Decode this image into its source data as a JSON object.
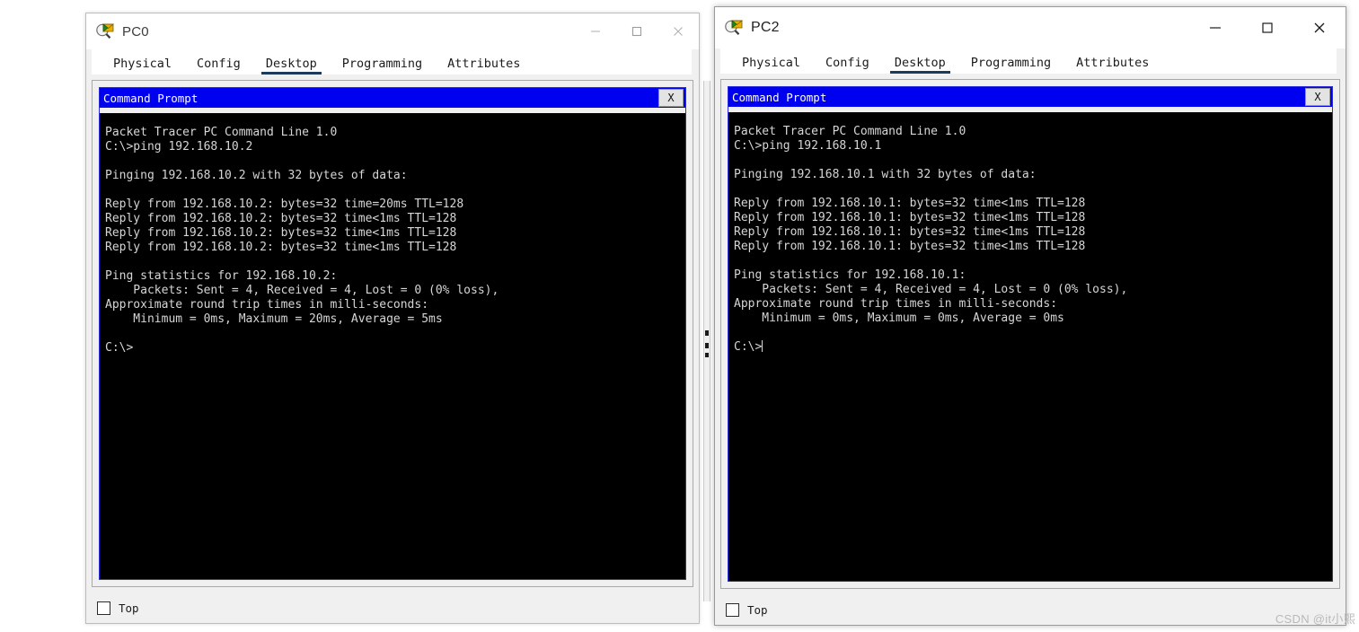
{
  "watermark": "CSDN @it小熙",
  "windows": [
    {
      "id": "pc0",
      "title": "PC0",
      "icon": "packet-tracer-device-icon",
      "controls": {
        "minimize": "–",
        "maximize": "□",
        "close": "✕"
      },
      "tabs": [
        {
          "label": "Physical",
          "selected": false
        },
        {
          "label": "Config",
          "selected": false
        },
        {
          "label": "Desktop",
          "selected": true
        },
        {
          "label": "Programming",
          "selected": false
        },
        {
          "label": "Attributes",
          "selected": false
        }
      ],
      "command_prompt": {
        "title": "Command Prompt",
        "close_label": "X",
        "show_cursor": false,
        "lines": [
          "Packet Tracer PC Command Line 1.0",
          "C:\\>ping 192.168.10.2",
          "",
          "Pinging 192.168.10.2 with 32 bytes of data:",
          "",
          "Reply from 192.168.10.2: bytes=32 time=20ms TTL=128",
          "Reply from 192.168.10.2: bytes=32 time<1ms TTL=128",
          "Reply from 192.168.10.2: bytes=32 time<1ms TTL=128",
          "Reply from 192.168.10.2: bytes=32 time<1ms TTL=128",
          "",
          "Ping statistics for 192.168.10.2:",
          "    Packets: Sent = 4, Received = 4, Lost = 0 (0% loss),",
          "Approximate round trip times in milli-seconds:",
          "    Minimum = 0ms, Maximum = 20ms, Average = 5ms",
          "",
          "C:\\>"
        ]
      },
      "footer": {
        "checkbox_label": "Top",
        "checked": false
      }
    },
    {
      "id": "pc2",
      "title": "PC2",
      "icon": "packet-tracer-device-icon",
      "controls": {
        "minimize": "–",
        "maximize": "□",
        "close": "✕"
      },
      "tabs": [
        {
          "label": "Physical",
          "selected": false
        },
        {
          "label": "Config",
          "selected": false
        },
        {
          "label": "Desktop",
          "selected": true
        },
        {
          "label": "Programming",
          "selected": false
        },
        {
          "label": "Attributes",
          "selected": false
        }
      ],
      "command_prompt": {
        "title": "Command Prompt",
        "close_label": "X",
        "show_cursor": true,
        "lines": [
          "Packet Tracer PC Command Line 1.0",
          "C:\\>ping 192.168.10.1",
          "",
          "Pinging 192.168.10.1 with 32 bytes of data:",
          "",
          "Reply from 192.168.10.1: bytes=32 time<1ms TTL=128",
          "Reply from 192.168.10.1: bytes=32 time<1ms TTL=128",
          "Reply from 192.168.10.1: bytes=32 time<1ms TTL=128",
          "Reply from 192.168.10.1: bytes=32 time<1ms TTL=128",
          "",
          "Ping statistics for 192.168.10.1:",
          "    Packets: Sent = 4, Received = 4, Lost = 0 (0% loss),",
          "Approximate round trip times in milli-seconds:",
          "    Minimum = 0ms, Maximum = 0ms, Average = 0ms",
          "",
          "C:\\>"
        ]
      },
      "footer": {
        "checkbox_label": "Top",
        "checked": false
      }
    }
  ],
  "colors": {
    "cmd_titlebar": "#0000f0",
    "terminal_bg": "#000000",
    "terminal_fg": "#d6d6d6",
    "tab_underline": "#1b3a5c",
    "window_bg": "#f0f0f0"
  }
}
